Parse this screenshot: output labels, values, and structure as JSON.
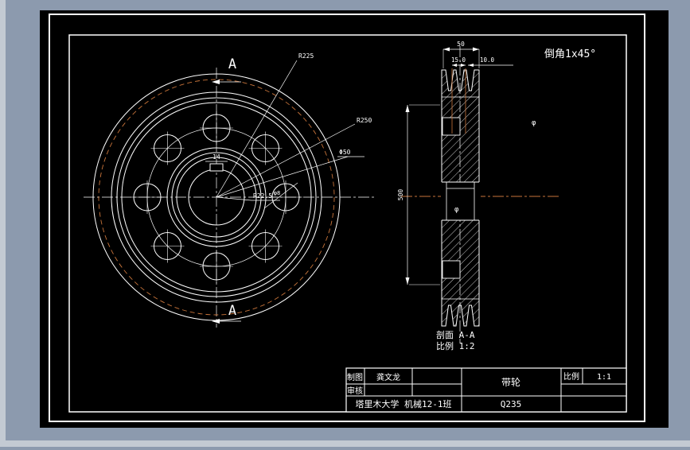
{
  "app": {
    "background_color": "#8c9aae",
    "sheet_color": "#000000",
    "line_color": "#ffffff",
    "accent_color": "#c8743a"
  },
  "front_view": {
    "section_letter_top": "A",
    "section_letter_bottom": "A",
    "dim_r225": "R225",
    "dim_r250": "R250",
    "dim_phi50": "Φ50",
    "dim_r22_5": "R22.5",
    "dim_keyway_width": "14",
    "dim_hole": "φ8"
  },
  "section_view": {
    "dim_width": "50",
    "dim_groove_pitch": "15.0",
    "dim_edge_offset": "10.0",
    "dim_diameter": "500",
    "phi_upper": "φ",
    "phi_lower": "φ",
    "chamfer_note": "倒角1x45°",
    "caption_line1": "剖面 A-A",
    "caption_line2": "比例 1:2"
  },
  "title_block": {
    "drafter_label": "制图",
    "drafter_name": "龚文龙",
    "checker_label": "审核",
    "checker_name": "",
    "part_name": "带轮",
    "scale_label": "比例",
    "scale_value": "1:1",
    "organization": "塔里木大学  机械12-1班",
    "material": "Q235"
  }
}
